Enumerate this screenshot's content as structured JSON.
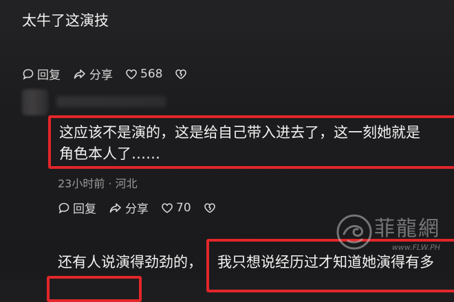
{
  "comments": [
    {
      "text": "太牛了这演技",
      "actions": {
        "reply": "回复",
        "share": "分享",
        "likes": "568"
      }
    },
    {
      "text_line1": "这应该不是演的，这是给自己带入进去了，这一刻她就是",
      "text_line2": "角色本人了……",
      "meta": "23小时前 · 河北",
      "actions": {
        "reply": "回复",
        "share": "分享",
        "likes": "70"
      }
    },
    {
      "text_part1": "还有人说演得劲劲的，",
      "text_part2": "我只想说经历过才知道她演得有多"
    }
  ],
  "watermark": {
    "text": "菲龍網",
    "url": "www.FLW.PH"
  },
  "colors": {
    "highlight": "#e3262a",
    "background": "#1d1d1f"
  }
}
